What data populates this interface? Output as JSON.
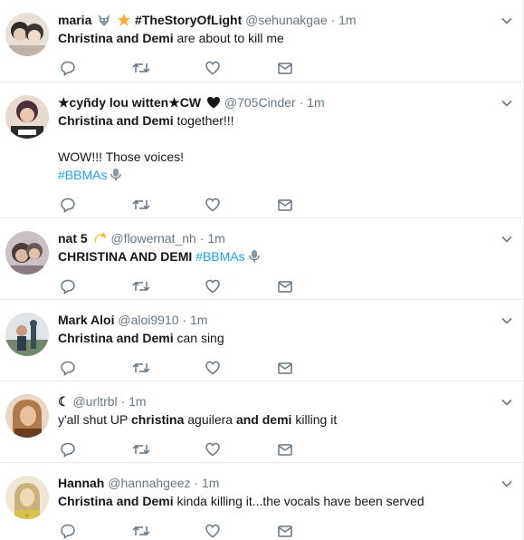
{
  "tweets": [
    {
      "name": "maria",
      "handle": "@sehunakgae",
      "time": "1m",
      "extra": "#TheStoryOfLight",
      "lines": [
        [
          "b",
          "Christina and Demi"
        ],
        [
          "t",
          " are about to kill me"
        ]
      ],
      "avatar_colors": [
        "#3a3a3a",
        "#c9b8a8",
        "#f1e6da"
      ]
    },
    {
      "name": "★cyñdy lou witten★CW",
      "handle": "@705Cinder",
      "time": "1m",
      "lines1": [
        [
          "b",
          "Christina and Demi"
        ],
        [
          "t",
          " together!!!"
        ]
      ],
      "line2": "WOW!!! Those voices!",
      "hashtag": "#BBMAs",
      "avatar_colors": [
        "#6a4a5a",
        "#e7c3ad",
        "#2b2b2b"
      ]
    },
    {
      "name": "nat 5",
      "handle": "@flowernat_nh",
      "time": "1m",
      "text": "CHRISTINA AND DEMI",
      "hashtag": "#BBMAs",
      "avatar_colors": [
        "#8a7a86",
        "#d8b9a3",
        "#4b3a35"
      ]
    },
    {
      "name": "Mark Aloi",
      "handle": "@aloi9910",
      "time": "1m",
      "bold": "Christina and Demi",
      "text": " can sing",
      "avatar_colors": [
        "#6f8a6a",
        "#3c4c58",
        "#dfe4e8"
      ]
    },
    {
      "name": "☾",
      "handle": "@urltrbl",
      "time": "1m",
      "p1": "y'all shut UP ",
      "b1": "christina",
      "p2": " aguilera ",
      "b2": "and demi",
      "p3": " killing it",
      "avatar_colors": [
        "#b07a4a",
        "#e8c19e",
        "#6a3b1f"
      ]
    },
    {
      "name": "Hannah",
      "handle": "@hannahgeez",
      "time": "1m",
      "bold": "Christina and Demi",
      "text": " kinda killing it...the vocals have been served",
      "avatar_colors": [
        "#c8b27a",
        "#f0d9b6",
        "#8a6a3a"
      ]
    }
  ],
  "icons": [
    "reply-icon",
    "retweet-icon",
    "like-icon",
    "message-icon",
    "caret-down-icon"
  ],
  "colors": {
    "action": "#657786",
    "link": "#1da1f2",
    "divider": "#e6ecf0",
    "text": "#14171a"
  }
}
